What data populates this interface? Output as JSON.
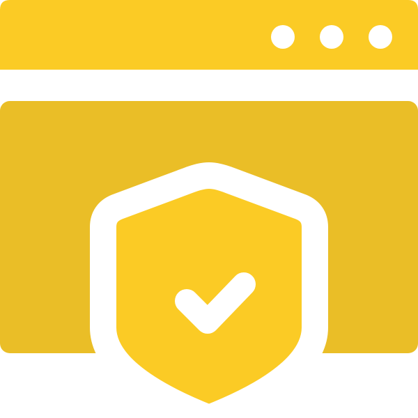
{
  "icon": {
    "name": "secure-browser-shield-icon",
    "colors": {
      "title_bar": "#FBCB25",
      "window_body": "#EABE27",
      "shield_fill": "#FBCB25",
      "outline": "#FFFFFF",
      "background": "#FFFFFF"
    },
    "window_controls": {
      "count": 3,
      "icon": "dot-icon"
    },
    "shield": {
      "icon": "shield-icon",
      "mark": "checkmark-icon"
    }
  }
}
